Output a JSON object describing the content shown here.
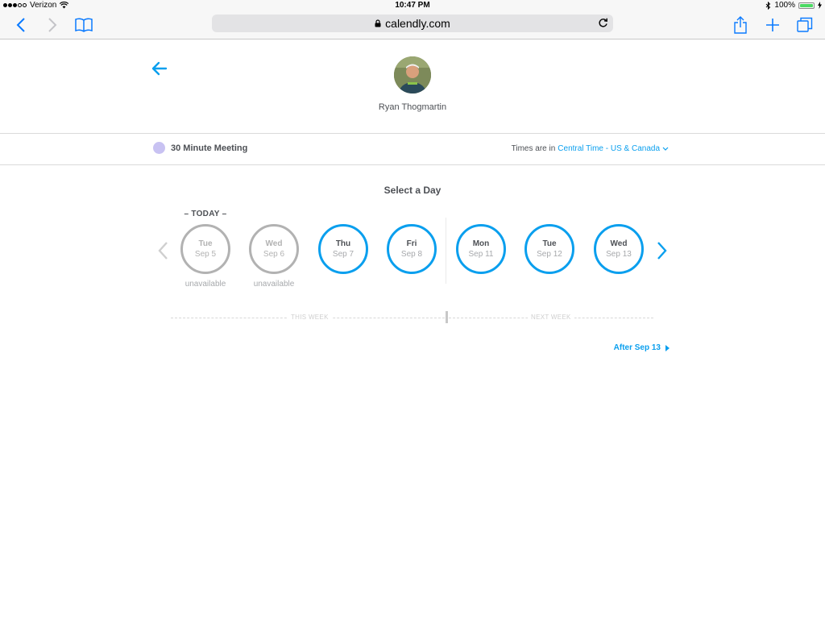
{
  "status_bar": {
    "carrier": "Verizon",
    "time": "10:47 PM",
    "battery_percent": "100%",
    "battery_level": 1.0
  },
  "browser": {
    "url": "calendly.com",
    "buttons": [
      "back-icon",
      "forward-icon",
      "bookmarks-icon",
      "reload-icon",
      "share-icon",
      "new-tab-icon",
      "tabs-icon"
    ]
  },
  "header": {
    "host_name": "Ryan Thogmartin"
  },
  "event": {
    "name": "30 Minute Meeting",
    "color": "#c8c2f2",
    "timezone_prefix": "Times are in",
    "timezone": "Central Time - US & Canada"
  },
  "picker": {
    "title": "Select a Day",
    "today_label": "– TODAY –",
    "unavailable_label": "unavailable",
    "days": [
      {
        "dow": "Tue",
        "date": "Sep 5",
        "available": false
      },
      {
        "dow": "Wed",
        "date": "Sep 6",
        "available": false
      },
      {
        "dow": "Thu",
        "date": "Sep 7",
        "available": true
      },
      {
        "dow": "Fri",
        "date": "Sep 8",
        "available": true
      },
      {
        "dow": "Mon",
        "date": "Sep 11",
        "available": true
      },
      {
        "dow": "Tue",
        "date": "Sep 12",
        "available": true
      },
      {
        "dow": "Wed",
        "date": "Sep 13",
        "available": true
      }
    ],
    "this_week_label": "THIS WEEK",
    "next_week_label": "NEXT WEEK",
    "after_label": "After Sep 13"
  },
  "colors": {
    "accent": "#0a9fee",
    "unavailable": "#b2b2b2"
  }
}
